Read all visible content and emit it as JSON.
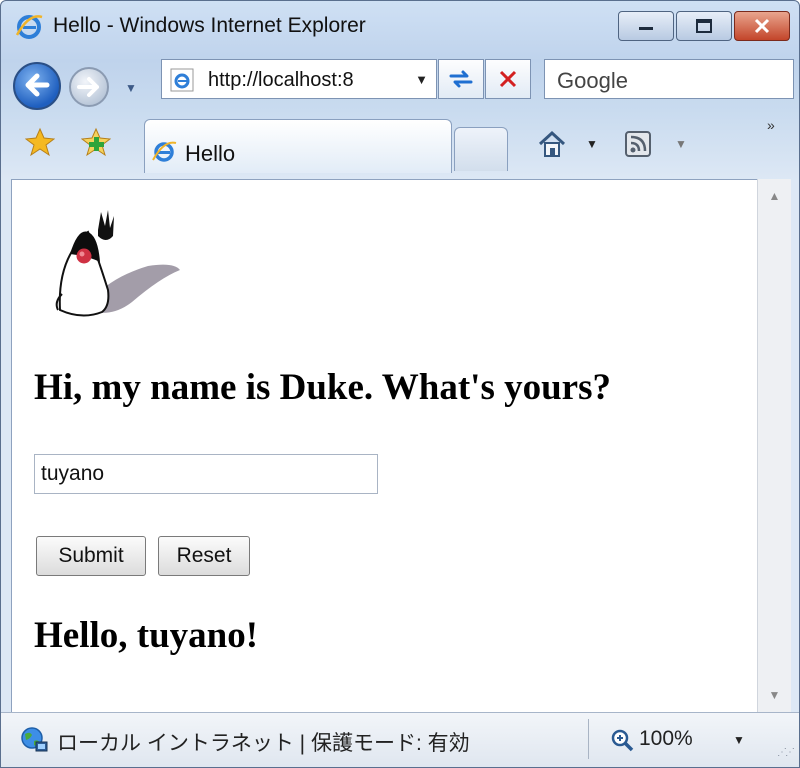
{
  "window": {
    "title": "Hello - Windows Internet Explorer"
  },
  "navigation": {
    "address_url": "http://localhost:8",
    "search_placeholder": "Google"
  },
  "tabs": [
    {
      "label": "Hello"
    }
  ],
  "page": {
    "heading": "Hi, my name is Duke. What's yours?",
    "name_input_value": "tuyano",
    "submit_label": "Submit",
    "reset_label": "Reset",
    "greeting": "Hello, tuyano!"
  },
  "status_bar": {
    "zone_text": "ローカル イントラネット | 保護モード: 有効",
    "zoom": "100%"
  },
  "icons": {
    "app": "ie-icon",
    "back": "back-arrow-icon",
    "forward": "forward-arrow-icon",
    "refresh": "refresh-icon",
    "stop": "stop-icon",
    "favorites": "star-icon",
    "add_favorites": "add-favorite-icon",
    "home": "home-icon",
    "feeds": "rss-icon",
    "zone": "globe-icon",
    "zoom": "magnifier-icon",
    "mascot": "duke-mascot-icon"
  }
}
